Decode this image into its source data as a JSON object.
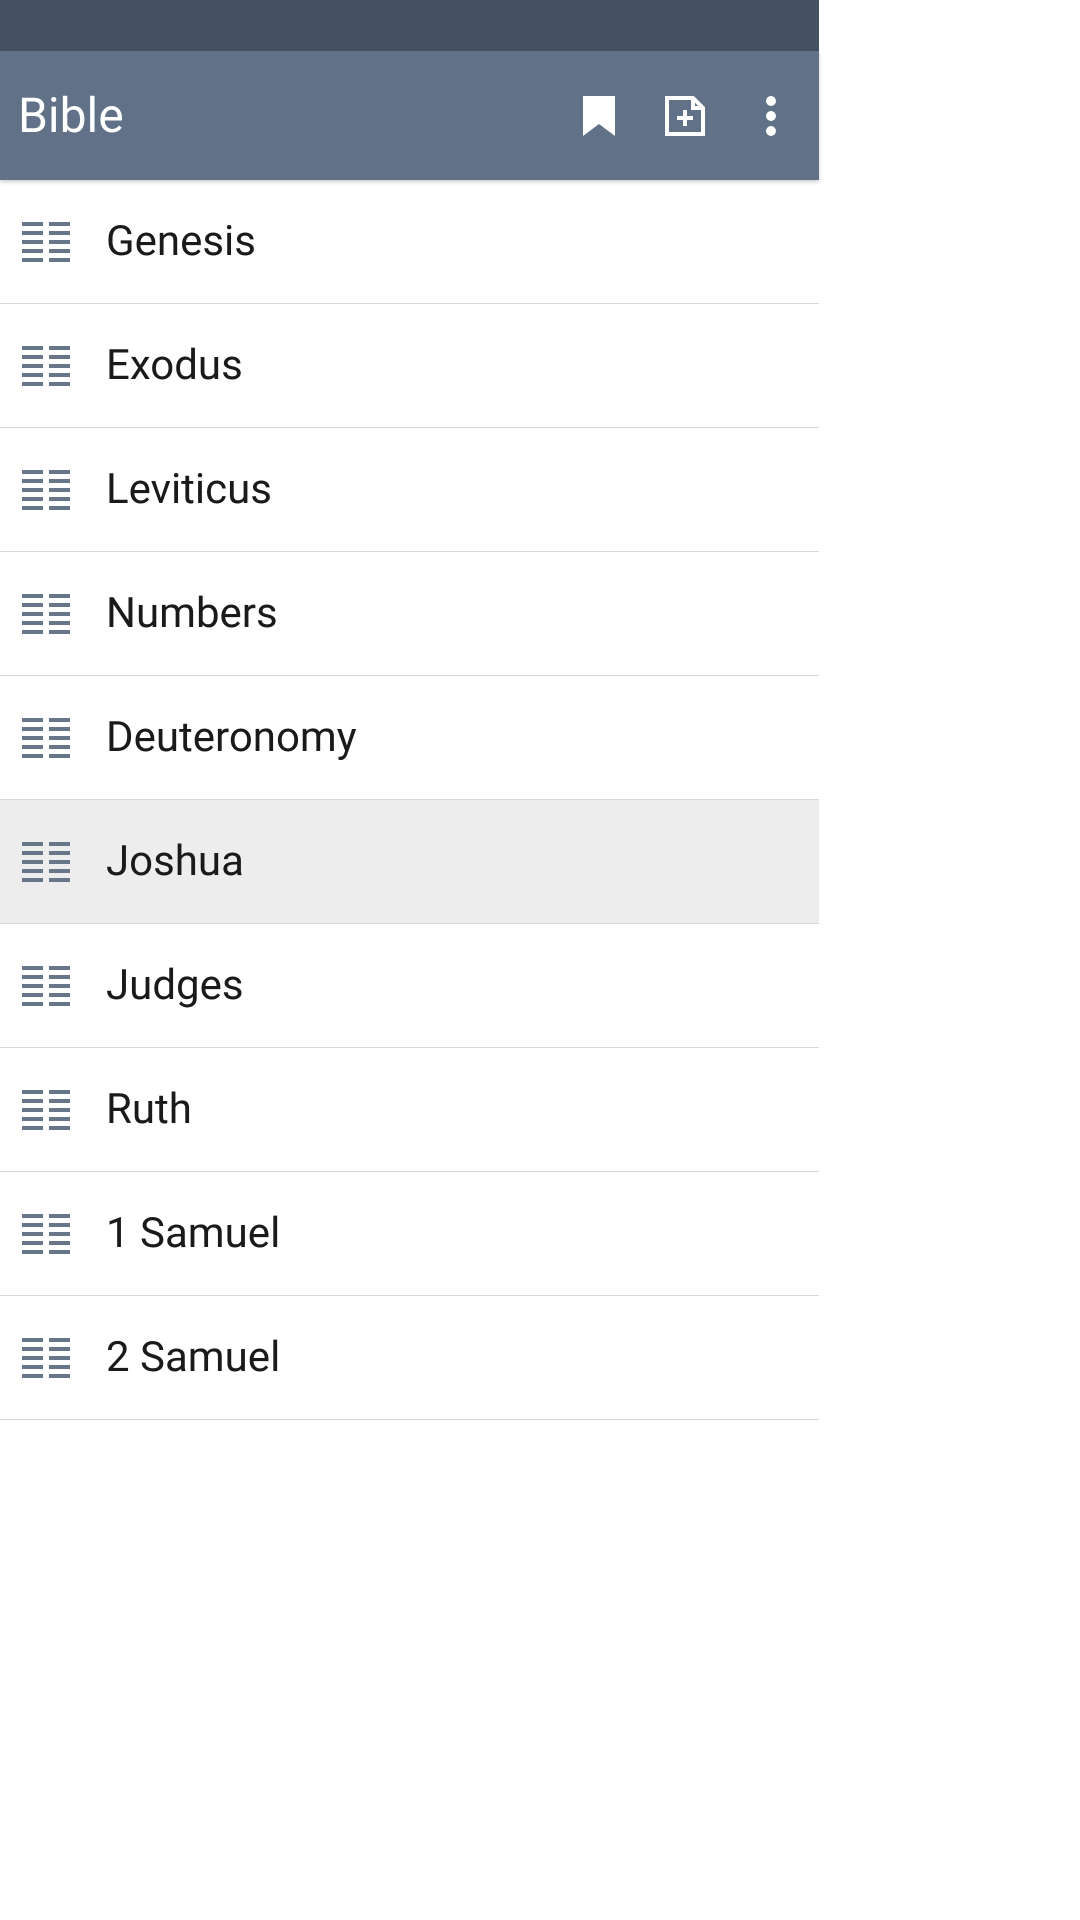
{
  "appBar": {
    "title": "Bible",
    "icons": {
      "bookmark": "bookmark-icon",
      "newNote": "new-note-icon",
      "menu": "more-icon"
    }
  },
  "books": [
    {
      "name": "Genesis",
      "selected": false
    },
    {
      "name": "Exodus",
      "selected": false
    },
    {
      "name": "Leviticus",
      "selected": false
    },
    {
      "name": "Numbers",
      "selected": false
    },
    {
      "name": "Deuteronomy",
      "selected": false
    },
    {
      "name": "Joshua",
      "selected": true
    },
    {
      "name": "Judges",
      "selected": false
    },
    {
      "name": "Ruth",
      "selected": false
    },
    {
      "name": "1 Samuel",
      "selected": false
    },
    {
      "name": "2 Samuel",
      "selected": false
    }
  ]
}
